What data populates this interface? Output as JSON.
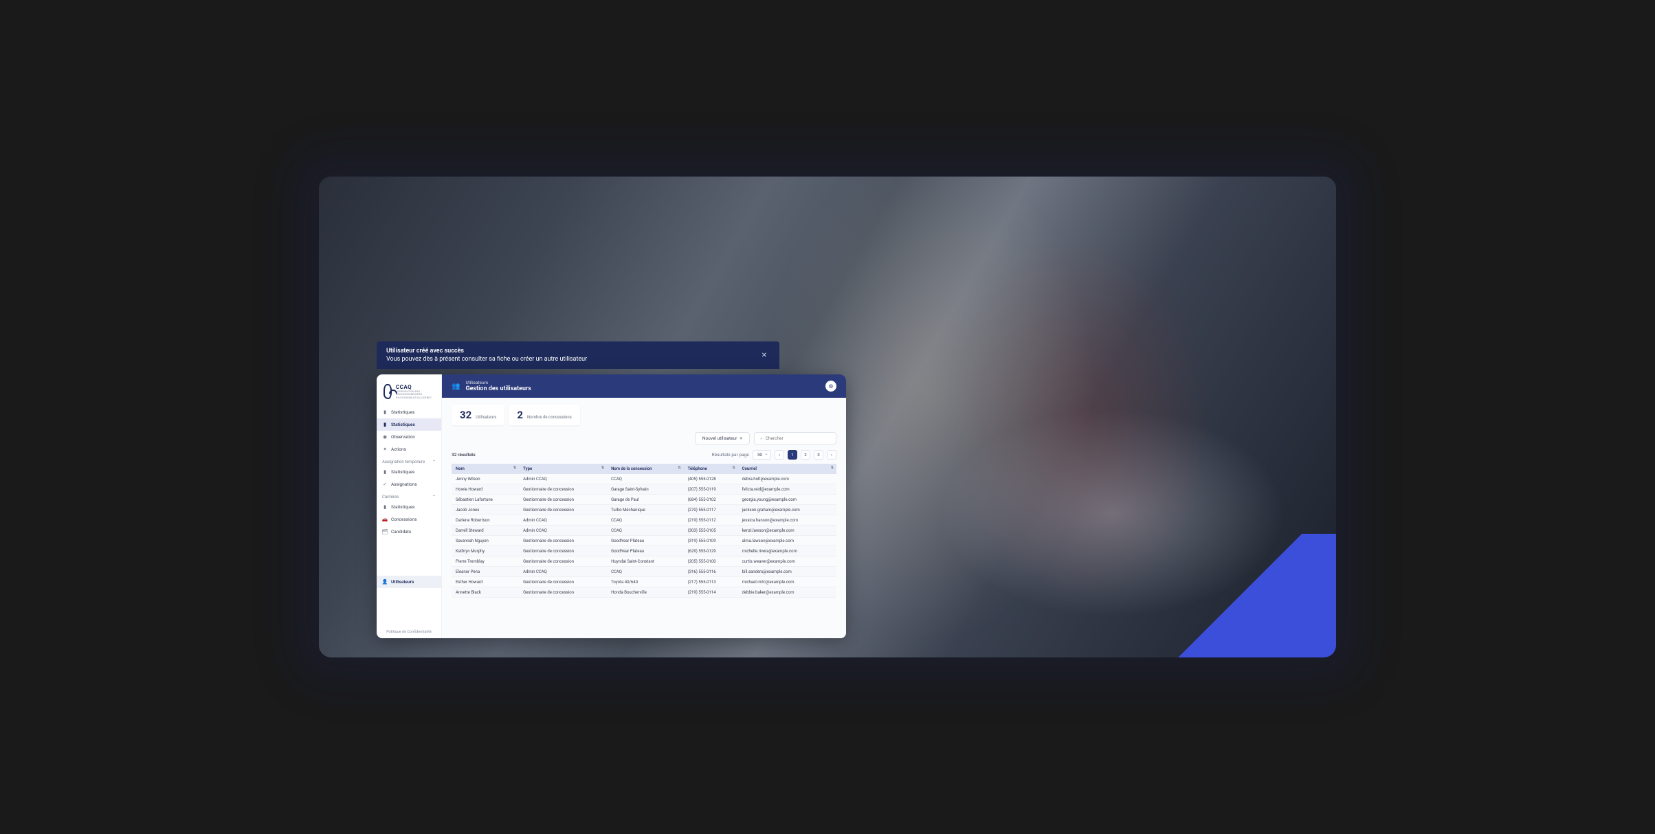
{
  "notification": {
    "title": "Utilisateur créé avec succès",
    "body": "Vous pouvez dès à présent consulter sa fiche ou créer un autre utilisateur"
  },
  "logo": {
    "name": "CCAQ",
    "sub": "CORPORATION DES CONCESSIONNAIRES D'AUTOMOBILES DU QUÉBEC"
  },
  "sidebar": {
    "root": [
      {
        "label": "Statistiques",
        "icon": "bar"
      },
      {
        "label": "Statistiques",
        "icon": "bar",
        "active": true
      },
      {
        "label": "Observation",
        "icon": "circle"
      },
      {
        "label": "Actions",
        "icon": "bolt"
      }
    ],
    "section1": {
      "title": "Assignation temporaire",
      "items": [
        {
          "label": "Statistiques",
          "icon": "bar"
        },
        {
          "label": "Assignations",
          "icon": "check"
        }
      ]
    },
    "section2": {
      "title": "Carrières",
      "items": [
        {
          "label": "Statistiques",
          "icon": "bar"
        },
        {
          "label": "Concessions",
          "icon": "car"
        },
        {
          "label": "Candidats",
          "icon": "folder"
        }
      ]
    },
    "bottom": {
      "label": "Utilisateurs",
      "icon": "user"
    },
    "footer": "Politique de Confidentialité"
  },
  "header": {
    "crumb": "Utilisateurs",
    "title": "Gestion des utilisateurs"
  },
  "stats": [
    {
      "num": "32",
      "label": "Utilisateurs"
    },
    {
      "num": "2",
      "label": "Nombre de concessions"
    }
  ],
  "toolbar": {
    "new_user": "Nouvel utilisateur",
    "search_placeholder": "Chercher"
  },
  "results": {
    "count_label": "32 résultats",
    "rpp_label": "Résultats par page",
    "rpp_value": "30",
    "pages": [
      "1",
      "2",
      "3"
    ],
    "current": "1"
  },
  "table": {
    "headers": [
      "Nom",
      "Type",
      "Nom de la concession",
      "Téléphone",
      "Courriel"
    ],
    "rows": [
      [
        "Jenny Wilson",
        "Admin CCAQ",
        "CCAQ",
        "(405) 555-0128",
        "debra.holt@example.com"
      ],
      [
        "Howie Howard",
        "Gestionnaire de concession",
        "Garage Saint-Sylvain",
        "(207) 555-0119",
        "felicia.reid@example.com"
      ],
      [
        "Sébastien Lafortune",
        "Gestionnaire de concession",
        "Garage de Paul",
        "(684) 555-0102",
        "georgia.young@example.com"
      ],
      [
        "Jacob Jones",
        "Gestionnaire de concession",
        "Turbo Méchanique",
        "(270) 555-0117",
        "jackson.graham@example.com"
      ],
      [
        "Darlene Robertson",
        "Admin CCAQ",
        "CCAQ",
        "(219) 555-0112",
        "jessica.hanson@example.com"
      ],
      [
        "Darrell Steward",
        "Admin CCAQ",
        "CCAQ",
        "(303) 555-0105",
        "kenzi.lawson@example.com"
      ],
      [
        "Savannah Nguyen",
        "Gestionnaire de concession",
        "GoodYear Plateau",
        "(319) 555-0109",
        "alma.lawson@example.com"
      ],
      [
        "Kathryn Murphy",
        "Gestionnaire de concession",
        "GoodYear Plateau",
        "(629) 555-0129",
        "michelle.rivera@example.com"
      ],
      [
        "Pierre Tremblay",
        "Gestionnaire de concession",
        "Huyndai Saint-Constant",
        "(205) 555-0100",
        "curtis.weaver@example.com"
      ],
      [
        "Eleanor Pena",
        "Admin CCAQ",
        "CCAQ",
        "(316) 555-0116",
        "bill.sanders@example.com"
      ],
      [
        "Esther Howard",
        "Gestionnaire de concession",
        "Toyota 40/640",
        "(217) 555-0113",
        "michael.mitc@example.com"
      ],
      [
        "Annette Black",
        "Gestionnaire de concession",
        "Honda Boucherville",
        "(219) 555-0114",
        "debbie.baker@example.com"
      ]
    ]
  }
}
